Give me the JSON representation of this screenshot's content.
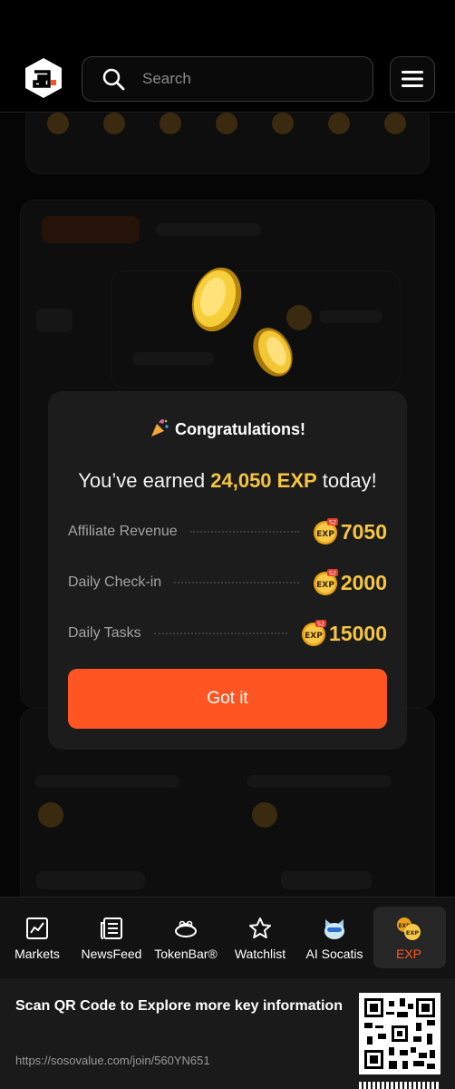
{
  "header": {
    "search_placeholder": "Search"
  },
  "modal": {
    "title": "Congratulations!",
    "earned_prefix": "You’ve earned ",
    "earned_amount": "24,050 EXP",
    "earned_suffix": " today!",
    "rows": [
      {
        "label": "Affiliate Revenue",
        "value": "7050"
      },
      {
        "label": "Daily Check-in",
        "value": "2000"
      },
      {
        "label": "Daily Tasks",
        "value": "15000"
      }
    ],
    "badge_text": "EXP",
    "badge_season": "S2",
    "button_label": "Got it"
  },
  "nav": {
    "items": [
      {
        "label": "Markets",
        "icon": "chart-icon"
      },
      {
        "label": "NewsFeed",
        "icon": "newspaper-icon"
      },
      {
        "label": "TokenBar®",
        "icon": "tokenbar-icon"
      },
      {
        "label": "Watchlist",
        "icon": "star-icon"
      },
      {
        "label": "AI Socatis",
        "icon": "ai-cat-icon"
      },
      {
        "label": "EXP",
        "icon": "exp-coin-icon",
        "active": true
      }
    ]
  },
  "footer": {
    "title": "Scan QR Code to Explore more key information",
    "url": "https://sosovalue.com/join/560YN651"
  },
  "colors": {
    "accent": "#ff5522",
    "gold": "#f6c443",
    "modal_bg": "#1c1c1c"
  }
}
